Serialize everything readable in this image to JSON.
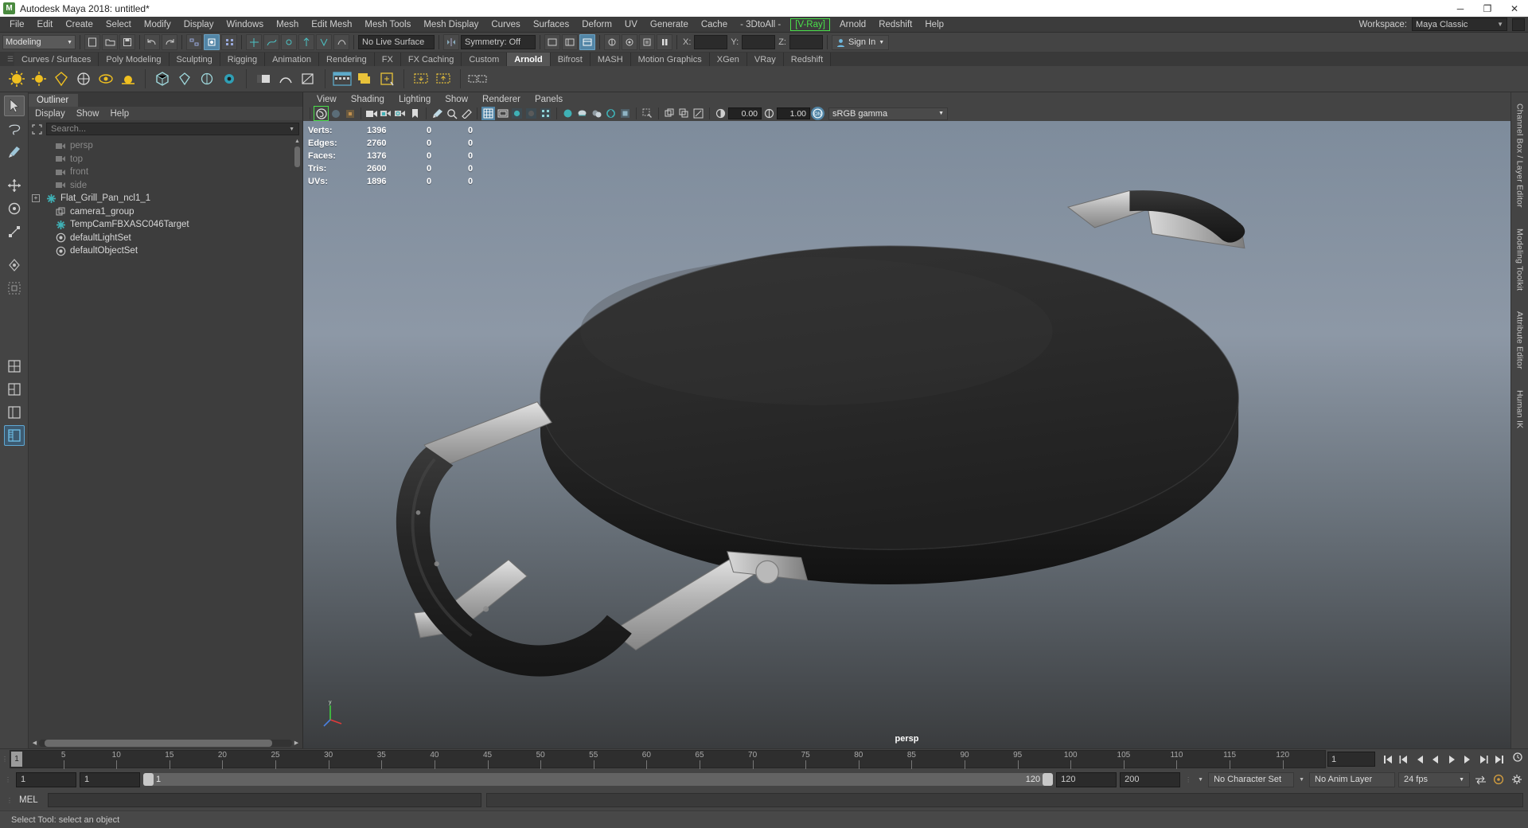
{
  "window": {
    "title": "Autodesk Maya 2018: untitled*",
    "logo": "M",
    "minimize": "─",
    "maximize": "❐",
    "close": "✕"
  },
  "menubar": {
    "items": [
      "File",
      "Edit",
      "Create",
      "Select",
      "Modify",
      "Display",
      "Windows",
      "Mesh",
      "Edit Mesh",
      "Mesh Tools",
      "Mesh Display",
      "Curves",
      "Surfaces",
      "Deform",
      "UV",
      "Generate",
      "Cache",
      "- 3DtoAll -"
    ],
    "highlighted": "[V-Ray]",
    "after_highlight": [
      "Arnold",
      "Redshift",
      "Help"
    ],
    "workspace_label": "Workspace:",
    "workspace_value": "Maya Classic"
  },
  "statusbar": {
    "mode": "Modeling",
    "no_live_surface": "No Live Surface",
    "symmetry": "Symmetry: Off",
    "axis_x": "X:",
    "axis_y": "Y:",
    "axis_z": "Z:",
    "axis_x_value": "",
    "axis_y_value": "",
    "axis_z_value": "",
    "sign_in": "Sign In"
  },
  "shelf": {
    "tabs": [
      "Curves / Surfaces",
      "Poly Modeling",
      "Sculpting",
      "Rigging",
      "Animation",
      "Rendering",
      "FX",
      "FX Caching",
      "Custom",
      "Arnold",
      "Bifrost",
      "MASH",
      "Motion Graphics",
      "XGen",
      "VRay",
      "Redshift"
    ],
    "active_tab": "Arnold"
  },
  "outliner": {
    "tab": "Outliner",
    "menu": [
      "Display",
      "Show",
      "Help"
    ],
    "search_placeholder": "Search...",
    "items": [
      {
        "label": "persp",
        "icon": "camera-icon",
        "dim": true,
        "expandable": false
      },
      {
        "label": "top",
        "icon": "camera-icon",
        "dim": true,
        "expandable": false
      },
      {
        "label": "front",
        "icon": "camera-icon",
        "dim": true,
        "expandable": false
      },
      {
        "label": "side",
        "icon": "camera-icon",
        "dim": true,
        "expandable": false
      },
      {
        "label": "Flat_Grill_Pan_ncl1_1",
        "icon": "transform-icon",
        "dim": false,
        "expandable": true
      },
      {
        "label": "camera1_group",
        "icon": "group-icon",
        "dim": false,
        "expandable": false
      },
      {
        "label": "TempCamFBXASC046Target",
        "icon": "transform-icon",
        "dim": false,
        "expandable": false
      },
      {
        "label": "defaultLightSet",
        "icon": "set-icon",
        "dim": false,
        "expandable": false
      },
      {
        "label": "defaultObjectSet",
        "icon": "set-icon",
        "dim": false,
        "expandable": false
      }
    ]
  },
  "viewport": {
    "menu": [
      "View",
      "Shading",
      "Lighting",
      "Show",
      "Renderer",
      "Panels"
    ],
    "exposure": "0.00",
    "gamma": "1.00",
    "color_profile": "sRGB gamma",
    "camera_label": "persp",
    "hud": {
      "rows": [
        {
          "label": "Verts:",
          "total": "1396",
          "selected": "0",
          "extra": "0"
        },
        {
          "label": "Edges:",
          "total": "2760",
          "selected": "0",
          "extra": "0"
        },
        {
          "label": "Faces:",
          "total": "1376",
          "selected": "0",
          "extra": "0"
        },
        {
          "label": "Tris:",
          "total": "2600",
          "selected": "0",
          "extra": "0"
        },
        {
          "label": "UVs:",
          "total": "1896",
          "selected": "0",
          "extra": "0"
        }
      ]
    },
    "axis": {
      "x": "x",
      "y": "y",
      "z": "z"
    }
  },
  "right_dock": {
    "items": [
      "Channel Box / Layer Editor",
      "Modeling Toolkit",
      "Attribute Editor",
      "Human IK"
    ]
  },
  "timeline": {
    "ticks": [
      5,
      10,
      15,
      20,
      25,
      30,
      35,
      40,
      45,
      50,
      55,
      60,
      65,
      70,
      75,
      80,
      85,
      90,
      95,
      100,
      105,
      110,
      115,
      120
    ],
    "current_frame": "1",
    "current_frame_field": "1",
    "playback_buttons": [
      "skip-to-start",
      "step-back-key",
      "step-back",
      "play-backward",
      "play-forward",
      "step-forward",
      "step-forward-key",
      "skip-to-end"
    ]
  },
  "range": {
    "start_field": "1",
    "current_field": "1",
    "slider_start": "1",
    "slider_end": "120",
    "end_field": "120",
    "max_field": "200",
    "character_set": "No Character Set",
    "anim_layer": "No Anim Layer",
    "fps": "24 fps"
  },
  "command_line": {
    "label": "MEL",
    "input_value": "",
    "output_value": ""
  },
  "status_text": "Select Tool: select an object",
  "colors": {
    "accent_blue": "#5285a6",
    "vray_green": "#4ae04a",
    "panel_bg": "#444444",
    "outliner_bg": "#3d3d3d",
    "teal": "#3fb0b5"
  }
}
